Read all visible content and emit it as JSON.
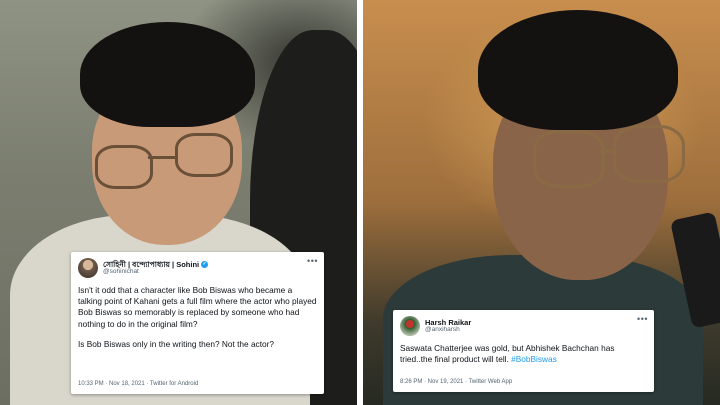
{
  "left_tweet": {
    "display_name": "সোহিনী | বন্দ্যোপাধ্যায় | Sohini",
    "handle": "@sohinichat",
    "more_icon": "•••",
    "paragraph_1": "Isn't it odd that a character like Bob Biswas who became a talking point of  Kahani gets a full film where the actor who played Bob Biswas so memorably is replaced by someone who had nothing to do in the original film?",
    "paragraph_2": "Is Bob Biswas only in the writing then? Not the actor?",
    "meta": "10:33 PM · Nov 18, 2021 · Twitter for Android",
    "verified_glyph": "✓"
  },
  "right_tweet": {
    "display_name": "Harsh Raikar",
    "handle": "@anxiharsh",
    "more_icon": "•••",
    "body_text": "Saswata Chatterjee was gold, but Abhishek Bachchan has tried..the final product will tell. ",
    "hashtag": "#BobBiswas",
    "meta": "8:26 PM · Nov 19, 2021 · Twitter Web App"
  },
  "colors": {
    "link_blue": "#1d9bf0",
    "text_primary": "#0f1419",
    "text_secondary": "#536471"
  }
}
